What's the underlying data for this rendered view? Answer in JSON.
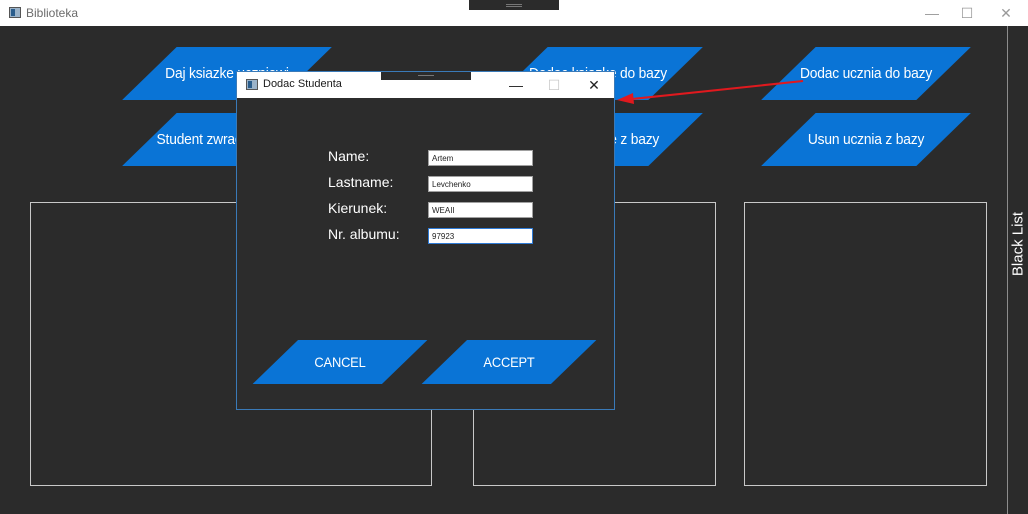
{
  "app": {
    "title": "Biblioteka"
  },
  "window_controls": {
    "minimize": "—",
    "maximize": "☐",
    "close": "✕"
  },
  "buttons": {
    "give_book": "Daj ksiazke uczniowi",
    "student_returns": "Student zwraca ksiazke",
    "add_book": "Dodac ksiazke do bazy",
    "remove_book": "Usun ksiazke z bazy",
    "add_student": "Dodac ucznia do bazy",
    "remove_student": "Usun ucznia z bazy"
  },
  "side_tab": {
    "label": "Black List"
  },
  "dialog": {
    "title": "Dodac Studenta",
    "controls": {
      "minimize": "—",
      "maximize": "☐",
      "close": "✕"
    },
    "fields": {
      "name": {
        "label": "Name:",
        "value": "Artem"
      },
      "lastname": {
        "label": "Lastname:",
        "value": "Levchenko"
      },
      "kierunek": {
        "label": "Kierunek:",
        "value": "WEAII"
      },
      "album": {
        "label": "Nr. albumu:",
        "value": "97923"
      }
    },
    "cancel": "CANCEL",
    "accept": "ACCEPT"
  },
  "colors": {
    "accent": "#0a74d6",
    "background": "#2b2b2b",
    "annotation_arrow": "#e0191e"
  }
}
